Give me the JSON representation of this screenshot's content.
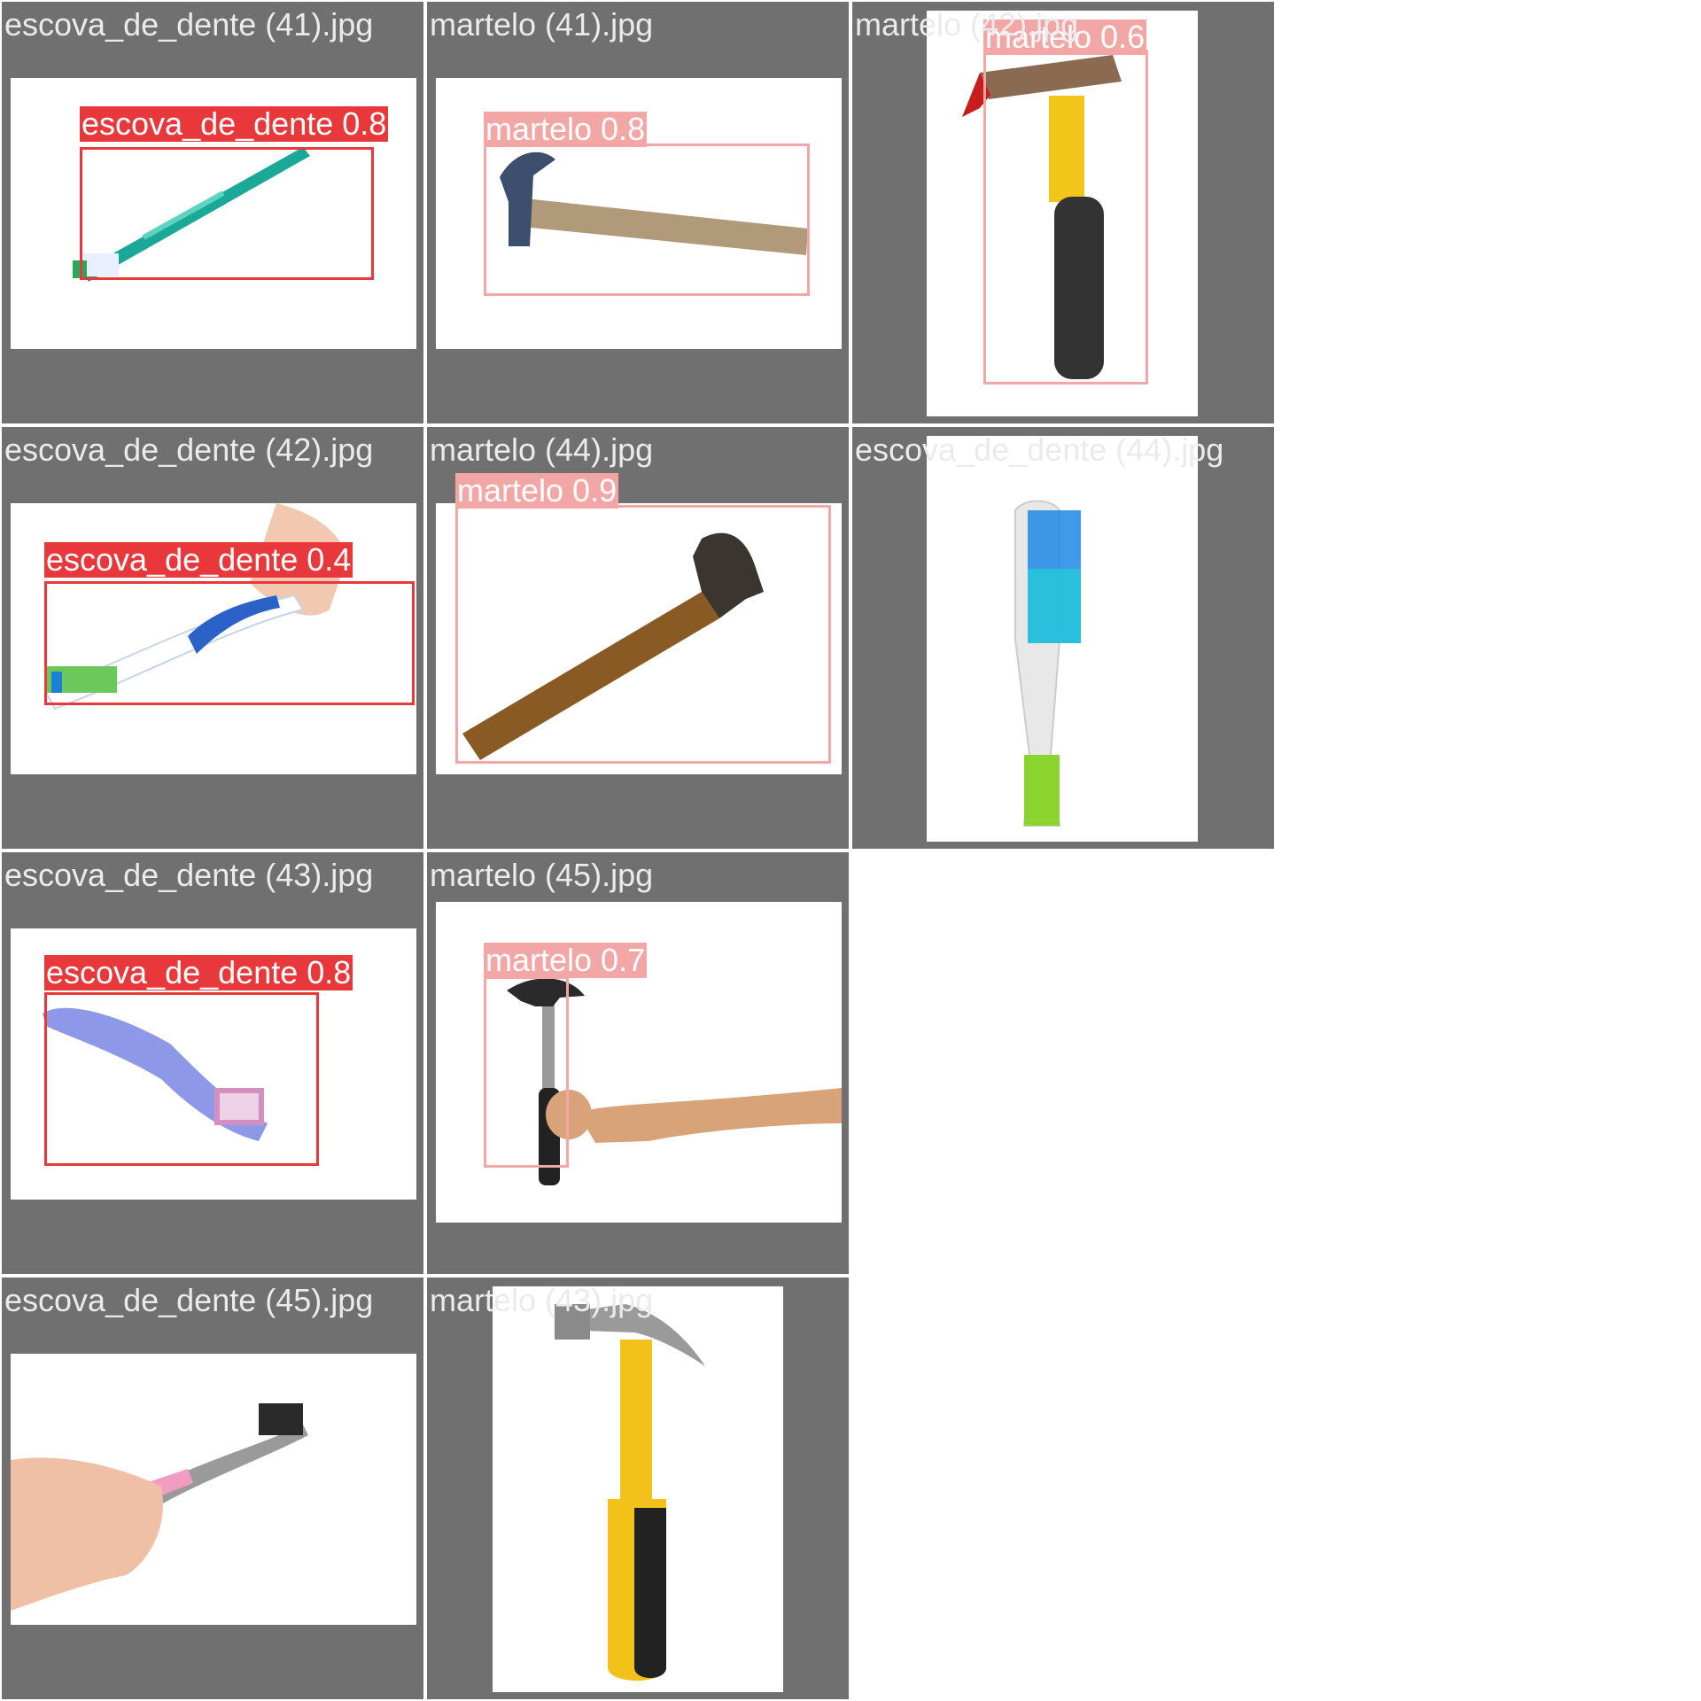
{
  "tiles": [
    {
      "filename": "escova_de_dente (41).jpg",
      "label": "escova_de_dente 0.8"
    },
    {
      "filename": "martelo (41).jpg",
      "label": "martelo 0.8"
    },
    {
      "filename": "martelo (42).jpg",
      "label": "martelo 0.6"
    },
    {
      "filename": "escova_de_dente (42).jpg",
      "label": "escova_de_dente 0.4"
    },
    {
      "filename": "martelo (44).jpg",
      "label": "martelo 0.9"
    },
    {
      "filename": "escova_de_dente (44).jpg",
      "label": ""
    },
    {
      "filename": "escova_de_dente (43).jpg",
      "label": "escova_de_dente 0.8"
    },
    {
      "filename": "martelo (45).jpg",
      "label": "martelo 0.7"
    },
    {
      "filename": "escova_de_dente (45).jpg",
      "label": ""
    },
    {
      "filename": "martelo (43).jpg",
      "label": ""
    }
  ],
  "colors": {
    "tile_background": "#707070",
    "escova_box": "#e8383b",
    "martelo_box": "#f3a6a6",
    "filename_text": "#ebebeb"
  }
}
